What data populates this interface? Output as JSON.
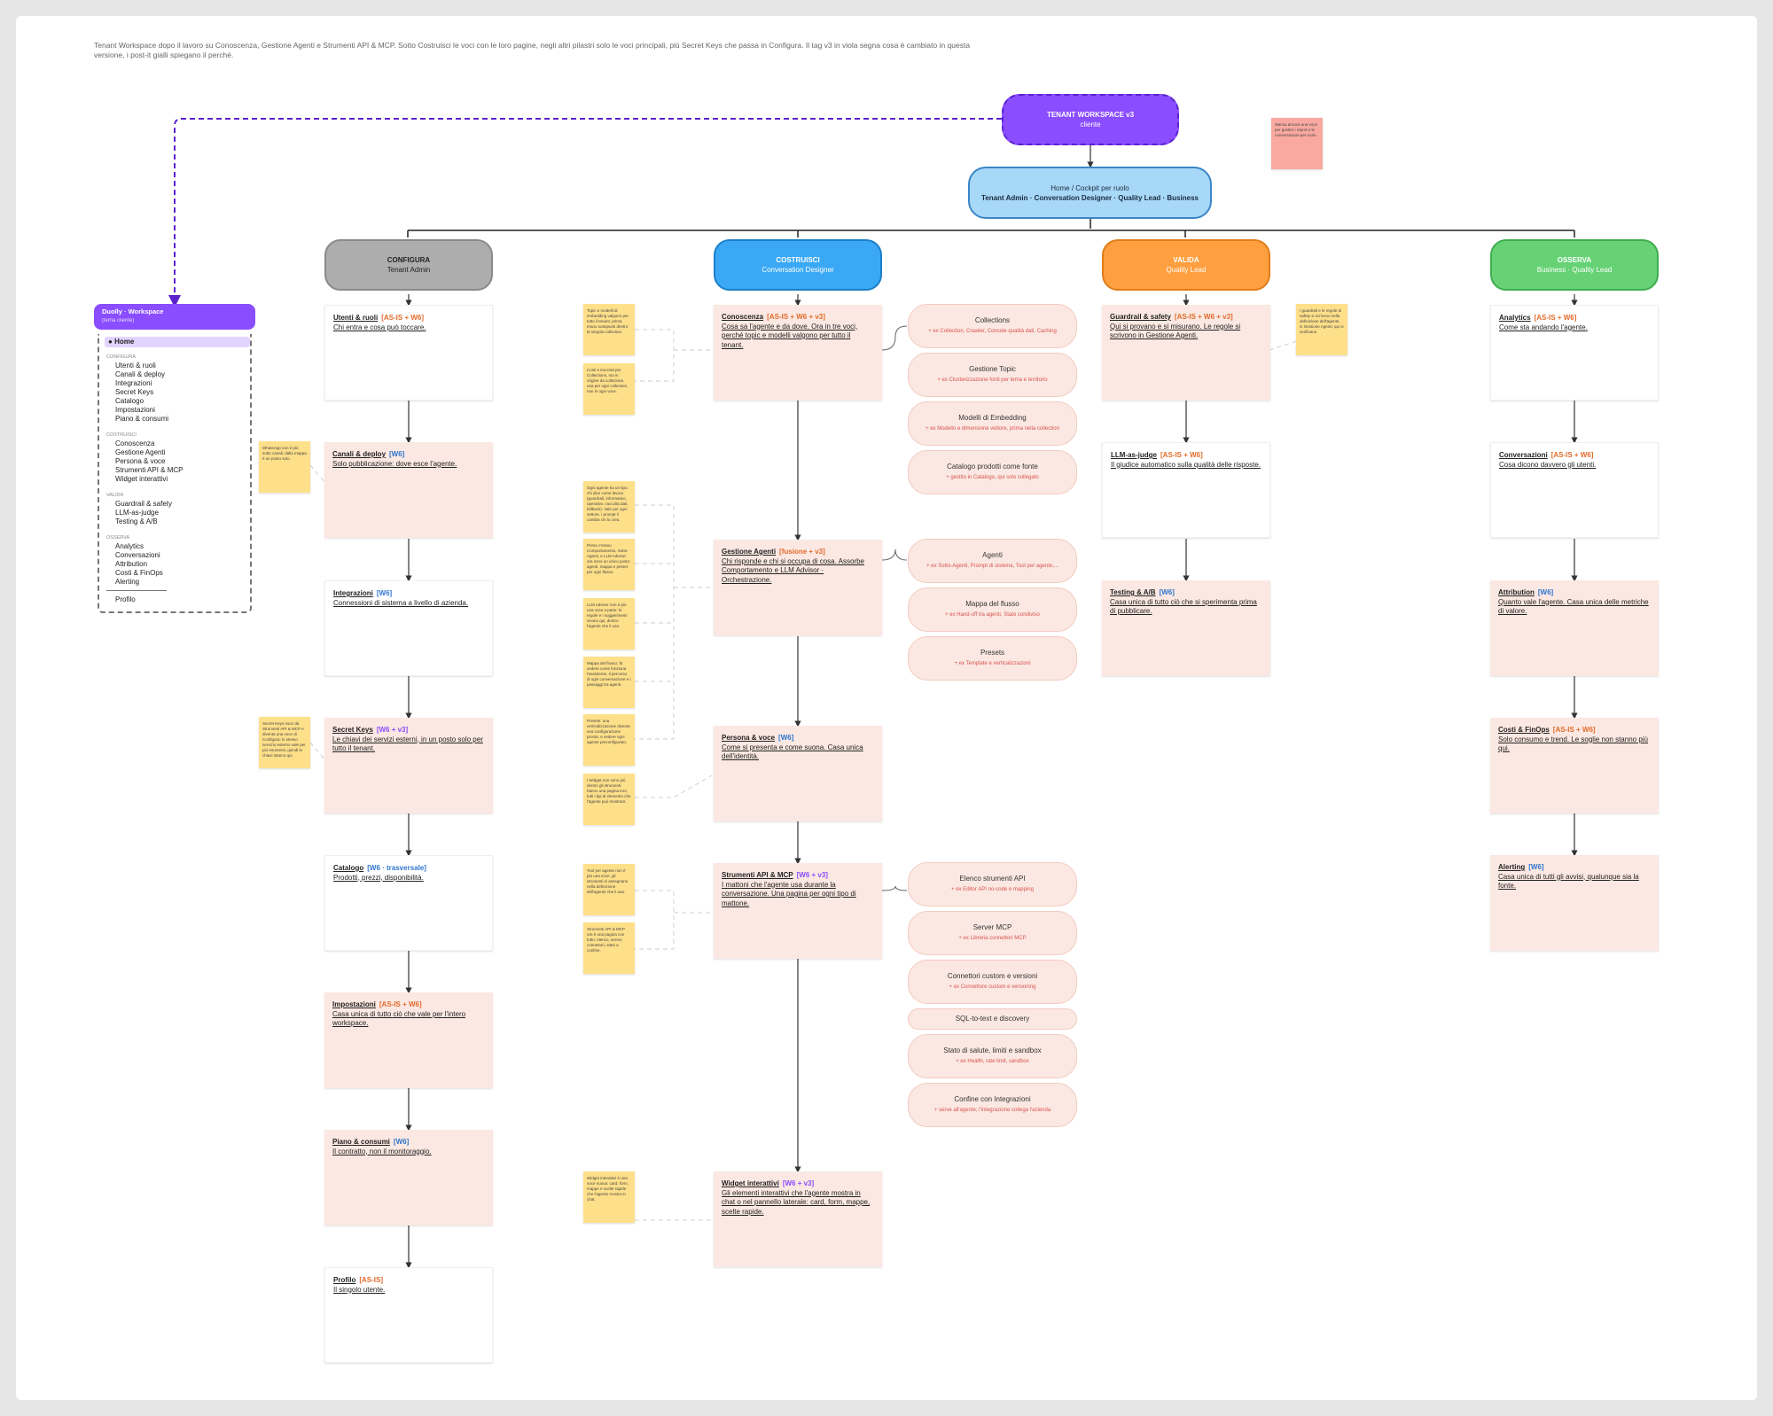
{
  "intro": "Tenant Workspace dopo il lavoro su Conoscenza, Gestione Agenti e Strumenti API & MCP. Sotto Costruisci le voci con le loro pagine, negli altri pilastri solo le voci principali, più Secret Keys che passa in Configura. Il tag v3 in viola segna cosa è cambiato in questa versione, i post-it gialli spiegano il perché.",
  "root": {
    "title": "TENANT WORKSPACE v3",
    "sub": "cliente"
  },
  "cockpit": {
    "title": "Home / Cockpit per ruolo",
    "sub": "Tenant Admin · Conversation Designer · Quality Lead · Business"
  },
  "colors": {
    "root": "#8a4dff",
    "cockpit": "#a8d8f7",
    "configura": "#adadad",
    "costruisci": "#3aa8f5",
    "valida": "#ff9f3f",
    "osserva": "#66d275",
    "card_pink": "#fbe8e2",
    "note": "#ffe08a"
  },
  "pillars": {
    "configura": {
      "title": "CONFIGURA",
      "role": "Tenant Admin"
    },
    "costruisci": {
      "title": "COSTRUISCI",
      "role": "Conversation Designer"
    },
    "valida": {
      "title": "VALIDA",
      "role": "Quality Lead"
    },
    "osserva": {
      "title": "OSSERVA",
      "role": "Business · Quality Lead"
    }
  },
  "cards": {
    "utenti": {
      "title": "Utenti & ruoli",
      "tag": "[AS-IS + W6]",
      "desc": "Chi entra e cosa può toccare."
    },
    "canali": {
      "title": "Canali & deploy",
      "tag": "[W6]",
      "desc": "Solo pubblicazione: dove esce l'agente."
    },
    "integrazioni": {
      "title": "Integrazioni",
      "tag": "[W6]",
      "desc": "Connessioni di sistema a livello di azienda."
    },
    "secret": {
      "title": "Secret Keys",
      "tag": "[W6 + v3]",
      "desc": "Le chiavi dei servizi esterni, in un posto solo per tutto il tenant."
    },
    "catalogo": {
      "title": "Catalogo",
      "tag": "[W6 · trasversale]",
      "desc": "Prodotti, prezzi, disponibilità."
    },
    "impostazioni": {
      "title": "Impostazioni",
      "tag": "[AS-IS + W6]",
      "desc": "Casa unica di tutto ciò che vale per l'intero workspace."
    },
    "piano": {
      "title": "Piano & consumi",
      "tag": "[W6]",
      "desc": "Il contratto, non il monitoraggio."
    },
    "profilo": {
      "title": "Profilo",
      "tag": "[AS-IS]",
      "desc": "Il singolo utente."
    },
    "conoscenza": {
      "title": "Conoscenza",
      "tag": "[AS-IS + W6 + v3]",
      "desc": "Cosa sa l'agente e da dove. Ora in tre voci, perché topic e modelli valgono per tutto il tenant."
    },
    "gestione": {
      "title": "Gestione Agenti",
      "tag": "[fusione + v3]",
      "desc": "Chi risponde e chi si occupa di cosa. Assorbe Comportamento e LLM Advisor · Orchestrazione."
    },
    "persona": {
      "title": "Persona & voce",
      "tag": "[W6]",
      "desc": "Come si presenta e come suona. Casa unica dell'identità."
    },
    "strumenti": {
      "title": "Strumenti API & MCP",
      "tag": "[W6 + v3]",
      "desc": "I mattoni che l'agente usa durante la conversazione. Una pagina per ogni tipo di mattone."
    },
    "widget": {
      "title": "Widget interattivi",
      "tag": "[W6 + v3]",
      "desc": "Gli elementi interattivi che l'agente mostra in chat o nel pannello laterale: card, form, mappe, scelte rapide."
    },
    "guardrail": {
      "title": "Guardrail & safety",
      "tag": "[AS-IS + W6 + v3]",
      "desc": "Qui si provano e si misurano. Le regole si scrivono in Gestione Agenti."
    },
    "llm": {
      "title": "LLM-as-judge",
      "tag": "[AS-IS + W6]",
      "desc": "Il giudice automatico sulla qualità delle risposte."
    },
    "testing": {
      "title": "Testing & A/B",
      "tag": "[W6]",
      "desc": "Casa unica di tutto ciò che si sperimenta prima di pubblicare."
    },
    "analytics": {
      "title": "Analytics",
      "tag": "[AS-IS + W6]",
      "desc": "Come sta andando l'agente."
    },
    "conversazioni": {
      "title": "Conversazioni",
      "tag": "[AS-IS + W6]",
      "desc": "Cosa dicono davvero gli utenti."
    },
    "attribution": {
      "title": "Attribution",
      "tag": "[W6]",
      "desc": "Quanto vale l'agente. Casa unica delle metriche di valore."
    },
    "costi": {
      "title": "Costi & FinOps",
      "tag": "[AS-IS + W6]",
      "desc": "Solo consumo e trend. Le soglie non stanno più qui."
    },
    "alerting": {
      "title": "Alerting",
      "tag": "[W6]",
      "desc": "Casa unica di tutti gli avvisi, qualunque sia la fonte."
    }
  },
  "subs": {
    "collections": {
      "name": "Collections",
      "sub": "+ ex Collection, Crawler, Console qualità dati, Caching"
    },
    "topic": {
      "name": "Gestione Topic",
      "sub": "+ ex Clusterizzazione fonti per tema e territorio"
    },
    "modelli": {
      "name": "Modelli di Embedding",
      "sub": "+ ex Modello e dimensione vettore, prima nella collection"
    },
    "catalogo_fonte": {
      "name": "Catalogo prodotti come fonte",
      "sub": "+ gestito in Catalogo, qui solo collegato"
    },
    "agenti": {
      "name": "Agenti",
      "sub": "+ ex Sotto-Agenti, Prompt di sistema, Tool per agente,..."
    },
    "mappa": {
      "name": "Mappa del flusso",
      "sub": "+ ex Hand-off tra agenti, Stato condiviso"
    },
    "presets": {
      "name": "Presets",
      "sub": "+ ex Template e verticalizzazioni"
    },
    "elenco": {
      "name": "Elenco strumenti API",
      "sub": "+ ex Editor API no-code e mapping"
    },
    "server": {
      "name": "Server MCP",
      "sub": "+ ex Libreria connettori MCP"
    },
    "connettori": {
      "name": "Connettori custom e versioni",
      "sub": "+ ex Connettore custom e versioning"
    },
    "sql": {
      "name": "SQL-to-text e discovery",
      "sub": ""
    },
    "stato": {
      "name": "Stato di salute, limiti e sandbox",
      "sub": "+ ex Health, rate limit, sandbox"
    },
    "confine": {
      "name": "Confine con Integrazioni",
      "sub": "+ serve all'agente; l'integrazione collega l'azienda"
    }
  },
  "notes": {
    "n1": "Topic e modelli di embedding valgono per tutto il tenant, prima erano sottopunti dentro la singola collection.",
    "n2": "Costi e tracciati per Collections, ma in origine da collezione, una per ogni collection, non in ogni voce.",
    "n3": "Ogni agente ha un tipo: chi dice come lavora (guardrail, informativo, operativo, raccolta dati, fallback). Vale per ogni settore, i prompt li cambia chi lo crea.",
    "n4": "Prima c'erano Comportamento, Sotto-Agenti, e LLM Advisor; ora sono un unico posto: agenti, mappa e preset per ogni flusso.",
    "n5": "LLM Advisor non è più una voce a parte: le regole e i suggerimenti vivono qui, dentro l'agente che li usa.",
    "n6": "Mappa del flusso: fa vedere come funziona l'assistente, il percorso di ogni conversazione e i passaggi tra agenti.",
    "n7": "Presets: una verticalizzazione diventa una configurazione pronta, e vedere ogni agente preconfigurato.",
    "n8": "I Widget non sono più dentro gli strumenti: hanno una pagina loro, tutti i tipi di elemento che l'agente può mostrare.",
    "n9": "Tool per agente non è più una voce, gli strumenti si assegnano nella definizione dell'agente che li usa.",
    "n10": "Strumenti API & MCP ora è una pagina con tutto: elenco, server, connettori, stato e confine.",
    "n11": "Widget interattivi è una voce nuova: card, form, mappe e scelte rapide che l'agente mostra in chat.",
    "n12": "WhatsApp non è più sotto canali: dalla mappa è un posto solo.",
    "n13": "Secret Keys esce da Strumenti API & MCP e diventa una voce di Configura: lo stesso servizio esterno vale per più strumenti, quindi le chiavi stanno qui.",
    "n14": "I guardrail e le regole di safety si scrivono nella definizione dell'agente, in Gestione Agenti; qui si verificano.",
    "n15": "Manca ancora una voce per gestire i report e le conversazioni per ruolo."
  },
  "sidebar": {
    "title": "Duolly · Workspace",
    "sub": "(tema cliente)",
    "home": "Home",
    "sec_configura": "CONFIGURA",
    "configura": [
      "Utenti & ruoli",
      "Canali & deploy",
      "Integrazioni",
      "Secret Keys",
      "Catalogo",
      "Impostazioni",
      "Piano & consumi"
    ],
    "sec_costruisci": "COSTRUISCI",
    "costruisci": [
      "Conoscenza",
      "Gestione Agenti",
      "Persona & voce",
      "Strumenti API & MCP",
      "Widget interattivi"
    ],
    "sec_valida": "VALIDA",
    "valida": [
      "Guardrail & safety",
      "LLM-as-judge",
      "Testing & A/B"
    ],
    "sec_osserva": "OSSERVA",
    "osserva": [
      "Analytics",
      "Conversazioni",
      "Attribution",
      "Costi & FinOps",
      "Alerting"
    ],
    "profilo": "Profilo"
  }
}
